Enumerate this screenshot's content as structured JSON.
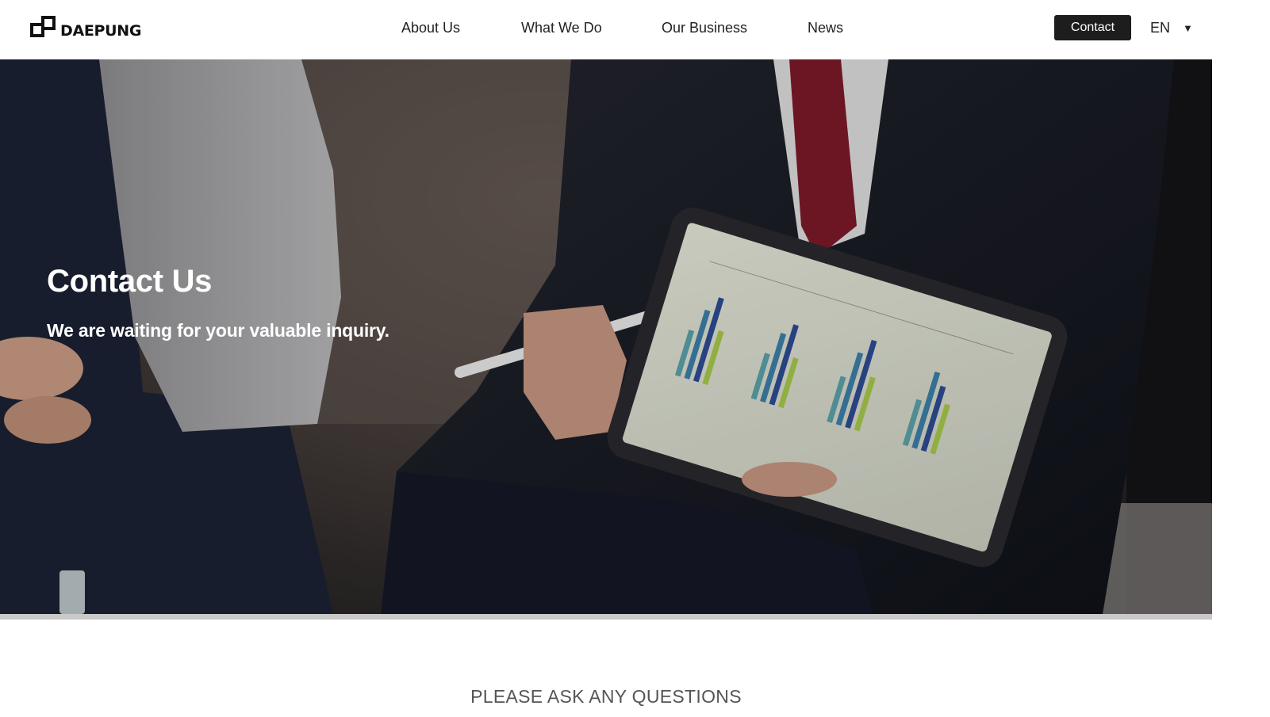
{
  "brand": {
    "name": "DAEPUNG"
  },
  "nav": {
    "items": [
      {
        "label": "About Us"
      },
      {
        "label": "What We Do"
      },
      {
        "label": "Our Business"
      },
      {
        "label": "News"
      }
    ],
    "contact_label": "Contact",
    "language": "EN",
    "language_caret": "▼"
  },
  "hero": {
    "title": "Contact Us",
    "subtitle": "We are waiting for your valuable inquiry."
  },
  "section": {
    "heading": "PLEASE ASK ANY QUESTIONS"
  },
  "colors": {
    "header_bg": "#ffffff",
    "contact_button_bg": "#1d1d1d",
    "hero_text": "#ffffff",
    "heading_text": "#555555",
    "divider": "#c9c9c9"
  },
  "icons": {
    "logo": "daepung-logo-icon",
    "language_dropdown": "caret-down-icon"
  }
}
